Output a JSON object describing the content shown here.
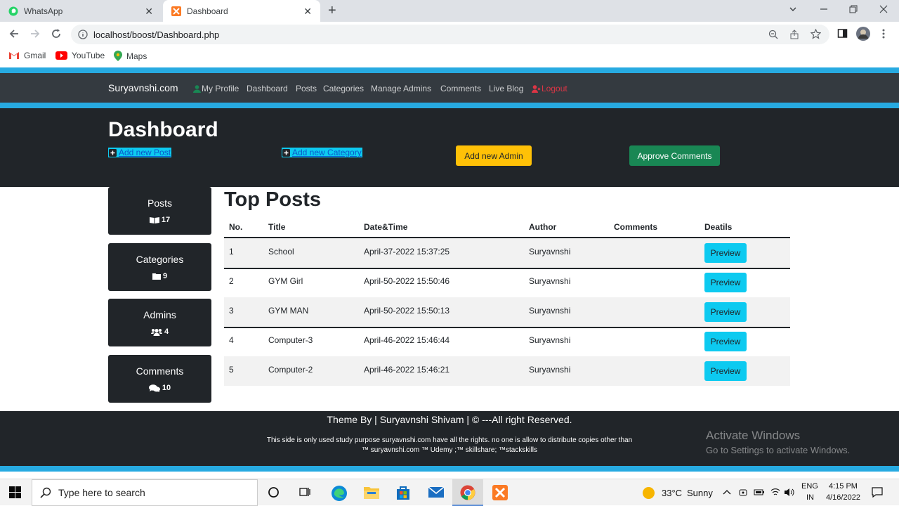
{
  "browser": {
    "tabs": [
      {
        "title": "WhatsApp",
        "active": false
      },
      {
        "title": "Dashboard",
        "active": true
      }
    ],
    "url": "localhost/boost/Dashboard.php",
    "bookmarks": [
      "Gmail",
      "YouTube",
      "Maps"
    ]
  },
  "nav": {
    "brand": "Suryavnshi.com",
    "links": [
      "My Profile",
      "Dashboard",
      "Posts",
      "Categories",
      "Manage Admins",
      "Comments",
      "Live Blog"
    ],
    "logout": "Logout"
  },
  "header": {
    "title": "Dashboard",
    "add_post": "Add new Post",
    "add_category": "Add new Category",
    "add_admin": "Add new Admin",
    "approve": "Approve Comments"
  },
  "sidebar": [
    {
      "label": "Posts",
      "count": "17",
      "icon": "book-icon"
    },
    {
      "label": "Categories",
      "count": "9",
      "icon": "folder-icon"
    },
    {
      "label": "Admins",
      "count": "4",
      "icon": "users-icon"
    },
    {
      "label": "Comments",
      "count": "10",
      "icon": "comments-icon"
    }
  ],
  "top_posts": {
    "title": "Top Posts",
    "headers": [
      "No.",
      "Title",
      "Date&Time",
      "Author",
      "Comments",
      "Deatils"
    ],
    "rows": [
      {
        "no": "1",
        "title": "School",
        "datetime": "April-37-2022 15:37:25",
        "author": "Suryavnshi",
        "action": "Preview"
      },
      {
        "no": "2",
        "title": "GYM Girl",
        "datetime": "April-50-2022 15:50:46",
        "author": "Suryavnshi",
        "action": "Preview"
      },
      {
        "no": "3",
        "title": "GYM MAN",
        "datetime": "April-50-2022 15:50:13",
        "author": "Suryavnshi",
        "action": "Preview"
      },
      {
        "no": "4",
        "title": "Computer-3",
        "datetime": "April-46-2022 15:46:44",
        "author": "Suryavnshi",
        "action": "Preview"
      },
      {
        "no": "5",
        "title": "Computer-2",
        "datetime": "April-46-2022 15:46:21",
        "author": "Suryavnshi",
        "action": "Preview"
      }
    ]
  },
  "footer": {
    "line1": "Theme By | Suryavnshi Shivam | © ---All right Reserved.",
    "line2": "This side is only used study purpose suryavnshi.com have all the rights. no one is allow to distribute copies other than",
    "line3": "™ suryavnshi.com ™ Udemy ;™ skillshare; ™stackskills",
    "watermark_title": "Activate Windows",
    "watermark_sub": "Go to Settings to activate Windows."
  },
  "taskbar": {
    "search_placeholder": "Type here to search",
    "weather_temp": "33°C",
    "weather_text": "Sunny",
    "lang1": "ENG",
    "lang2": "IN",
    "time": "4:15 PM",
    "date": "4/16/2022"
  },
  "colors": {
    "accent": "#27aae1",
    "dark": "#212529",
    "navbar": "#343a40",
    "info": "#0dcaf0",
    "warning": "#ffc107",
    "success": "#198754",
    "danger": "#dc3545"
  }
}
